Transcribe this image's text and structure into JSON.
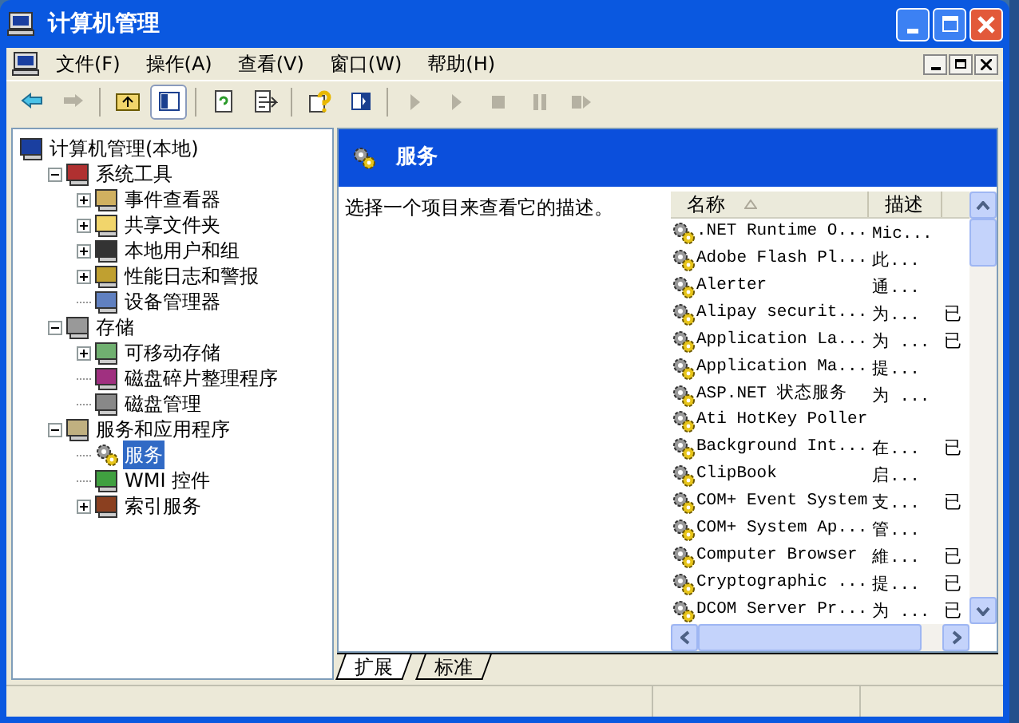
{
  "window": {
    "title": "计算机管理"
  },
  "menu": [
    "文件(F)",
    "操作(A)",
    "查看(V)",
    "窗口(W)",
    "帮助(H)"
  ],
  "toolbar": [
    {
      "kind": "back",
      "disabled": false
    },
    {
      "kind": "forward",
      "disabled": true
    },
    {
      "kind": "sep"
    },
    {
      "kind": "up",
      "disabled": false
    },
    {
      "kind": "tree",
      "disabled": false,
      "selected": true
    },
    {
      "kind": "sep"
    },
    {
      "kind": "refresh",
      "disabled": false
    },
    {
      "kind": "export",
      "disabled": false
    },
    {
      "kind": "sep"
    },
    {
      "kind": "help",
      "disabled": false
    },
    {
      "kind": "pane",
      "disabled": false
    },
    {
      "kind": "sep"
    },
    {
      "kind": "play",
      "disabled": true
    },
    {
      "kind": "play",
      "disabled": true
    },
    {
      "kind": "stop",
      "disabled": true
    },
    {
      "kind": "pause",
      "disabled": true
    },
    {
      "kind": "restart",
      "disabled": true
    }
  ],
  "tree": [
    {
      "label": "计算机管理(本地)",
      "selected": false,
      "children": [
        {
          "label": "系统工具",
          "expanded": true,
          "selected": false,
          "children": [
            {
              "label": "事件查看器",
              "expanded": false,
              "selected": false
            },
            {
              "label": "共享文件夹",
              "expanded": false,
              "selected": false
            },
            {
              "label": "本地用户和组",
              "expanded": false,
              "selected": false
            },
            {
              "label": "性能日志和警报",
              "expanded": false,
              "selected": false
            },
            {
              "label": "设备管理器",
              "selected": false
            }
          ]
        },
        {
          "label": "存储",
          "expanded": true,
          "selected": false,
          "children": [
            {
              "label": "可移动存储",
              "expanded": false,
              "selected": false
            },
            {
              "label": "磁盘碎片整理程序",
              "selected": false
            },
            {
              "label": "磁盘管理",
              "selected": false
            }
          ]
        },
        {
          "label": "服务和应用程序",
          "expanded": true,
          "selected": false,
          "children": [
            {
              "label": "服务",
              "selected": true
            },
            {
              "label": "WMI 控件",
              "selected": false
            },
            {
              "label": "索引服务",
              "expanded": false,
              "selected": false
            }
          ]
        }
      ]
    }
  ],
  "panel": {
    "title": "服务",
    "description": "选择一个项目来查看它的描述。"
  },
  "table": {
    "columns": [
      "名称",
      "描述"
    ],
    "rows": [
      {
        "name": ".NET Runtime O...",
        "description": "Mic...",
        "status": ""
      },
      {
        "name": "Adobe Flash Pl...",
        "description": "此...",
        "status": ""
      },
      {
        "name": "Alerter",
        "description": "通...",
        "status": ""
      },
      {
        "name": "Alipay securit...",
        "description": "为...",
        "status": "已"
      },
      {
        "name": "Application La...",
        "description": "为 ...",
        "status": "已"
      },
      {
        "name": "Application Ma...",
        "description": "提...",
        "status": ""
      },
      {
        "name": "ASP.NET 状态服务",
        "description": "为 ...",
        "status": ""
      },
      {
        "name": "Ati HotKey Poller",
        "description": "",
        "status": ""
      },
      {
        "name": "Background Int...",
        "description": "在...",
        "status": "已"
      },
      {
        "name": "ClipBook",
        "description": "启...",
        "status": ""
      },
      {
        "name": "COM+ Event System",
        "description": "支...",
        "status": "已"
      },
      {
        "name": "COM+ System Ap...",
        "description": "管...",
        "status": ""
      },
      {
        "name": "Computer Browser",
        "description": "維...",
        "status": "已"
      },
      {
        "name": "Cryptographic ...",
        "description": "提...",
        "status": "已"
      },
      {
        "name": "DCOM Server Pr...",
        "description": "为 ...",
        "status": "已"
      }
    ]
  },
  "tabs": [
    {
      "label": "扩展",
      "selected": true
    },
    {
      "label": "标准",
      "selected": false
    }
  ]
}
